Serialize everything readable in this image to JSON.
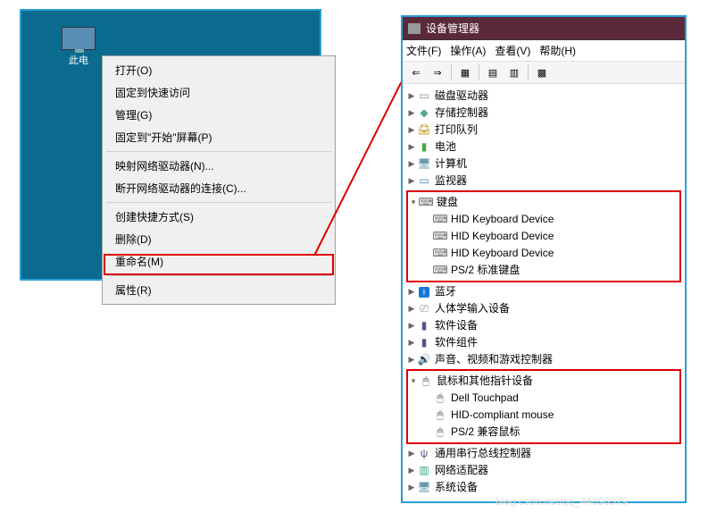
{
  "desktop": {
    "icon_label": "此电"
  },
  "context_menu": {
    "open": "打开(O)",
    "pin": "固定到快速访问",
    "manage": "管理(G)",
    "pin_start": "固定到\"开始\"屏幕(P)",
    "map_drive": "映射网络驱动器(N)...",
    "disconnect": "断开网络驱动器的连接(C)...",
    "shortcut": "创建快捷方式(S)",
    "delete": "删除(D)",
    "rename": "重命名(M)",
    "properties": "属性(R)"
  },
  "dm": {
    "title": "设备管理器",
    "menu": {
      "file": "文件(F)",
      "action": "操作(A)",
      "view": "查看(V)",
      "help": "帮助(H)"
    },
    "tree": {
      "disk": "磁盘驱动器",
      "storage": "存储控制器",
      "printer": "打印队列",
      "battery": "电池",
      "computer": "计算机",
      "monitor": "监视器",
      "keyboard": "键盘",
      "kb_hid1": "HID Keyboard Device",
      "kb_hid2": "HID Keyboard Device",
      "kb_hid3": "HID Keyboard Device",
      "kb_ps2": "PS/2 标准键盘",
      "bluetooth": "蓝牙",
      "hid": "人体学输入设备",
      "soft_dev": "软件设备",
      "soft_comp": "软件组件",
      "audio": "声音、视频和游戏控制器",
      "mouse": "鼠标和其他指针设备",
      "mouse_dell": "Dell Touchpad",
      "mouse_hid": "HID-compliant mouse",
      "mouse_ps2": "PS/2 兼容鼠标",
      "usb": "通用串行总线控制器",
      "network": "网络适配器",
      "system": "系统设备"
    }
  },
  "watermark": "blog.csdn.net/qq_44898379"
}
